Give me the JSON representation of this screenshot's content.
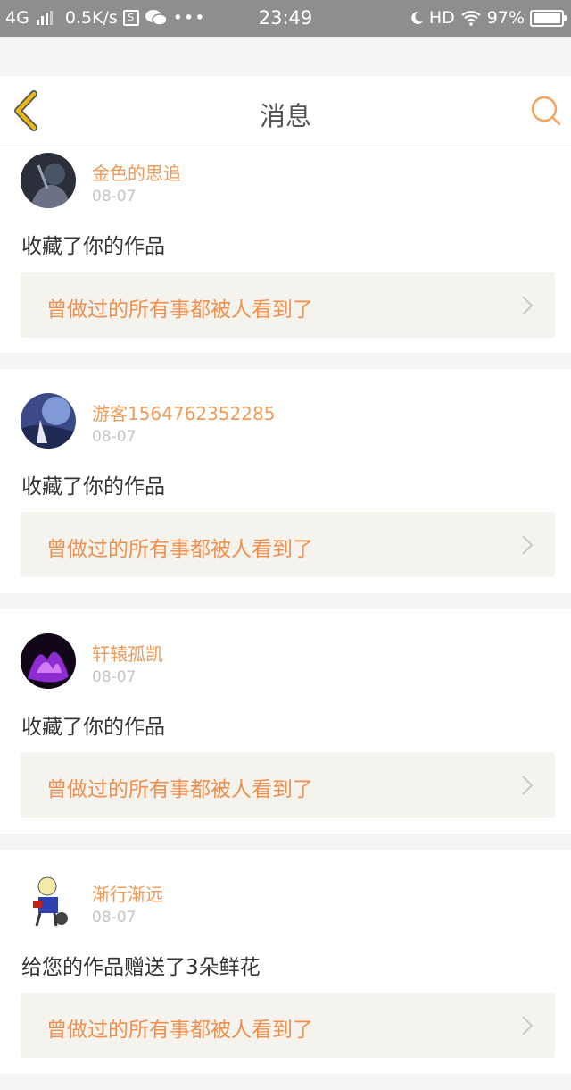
{
  "status_bar": {
    "network": "4G",
    "speed": "0.5K/s",
    "time": "23:49",
    "hd": "HD",
    "battery": "97%",
    "icons": [
      "signal-icon",
      "s-icon",
      "wechat-icon",
      "more-icon",
      "moon-icon",
      "wifi-icon",
      "battery-icon"
    ]
  },
  "header": {
    "title": "消息",
    "back_icon": "chevron-left-icon",
    "search_icon": "search-icon"
  },
  "colors": {
    "accent": "#f09a57",
    "back_icon": "#e8b917",
    "work_bg": "#f4f3ee",
    "page_bg": "#f4f4f4"
  },
  "messages": [
    {
      "username": "金色的思追",
      "date": "08-07",
      "action": "收藏了你的作品",
      "work_title": "曾做过的所有事都被人看到了"
    },
    {
      "username": "游客1564762352285",
      "date": "08-07",
      "action": "收藏了你的作品",
      "work_title": "曾做过的所有事都被人看到了"
    },
    {
      "username": "轩辕孤凯",
      "date": "08-07",
      "action": "收藏了你的作品",
      "work_title": "曾做过的所有事都被人看到了"
    },
    {
      "username": "渐行渐远",
      "date": "08-07",
      "action": "给您的作品赠送了3朵鲜花",
      "work_title": "曾做过的所有事都被人看到了"
    }
  ]
}
